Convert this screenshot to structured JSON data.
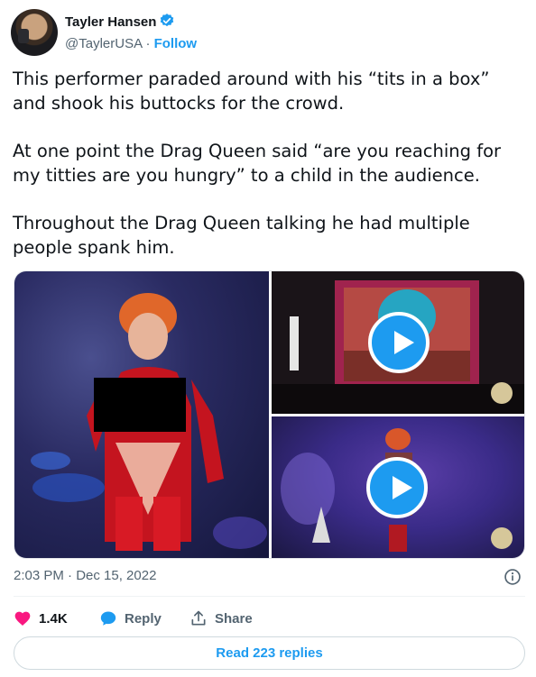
{
  "author": {
    "name": "Tayler Hansen",
    "handle": "@TaylerUSA",
    "separator": "·",
    "follow_label": "Follow"
  },
  "tweet": {
    "paragraphs": [
      "This performer paraded around with his “tits in a box” and shook his buttocks for the crowd.",
      "At one point the Drag Queen said “are you reaching for my titties are you hungry” to a child in the audience.",
      "Throughout the Drag Queen talking he had multiple people spank him."
    ],
    "timestamp": "2:03 PM · Dec 15, 2022"
  },
  "media": [
    {
      "kind": "photo",
      "icon": "performer-photo"
    },
    {
      "kind": "video",
      "icon": "play-icon"
    },
    {
      "kind": "video",
      "icon": "play-icon"
    }
  ],
  "actions": {
    "likes": "1.4K",
    "reply_label": "Reply",
    "share_label": "Share"
  },
  "read_replies_label": "Read 223 replies",
  "colors": {
    "accent": "#1d9bf0",
    "like": "#f91880",
    "text": "#0f1419",
    "muted": "#536471"
  }
}
